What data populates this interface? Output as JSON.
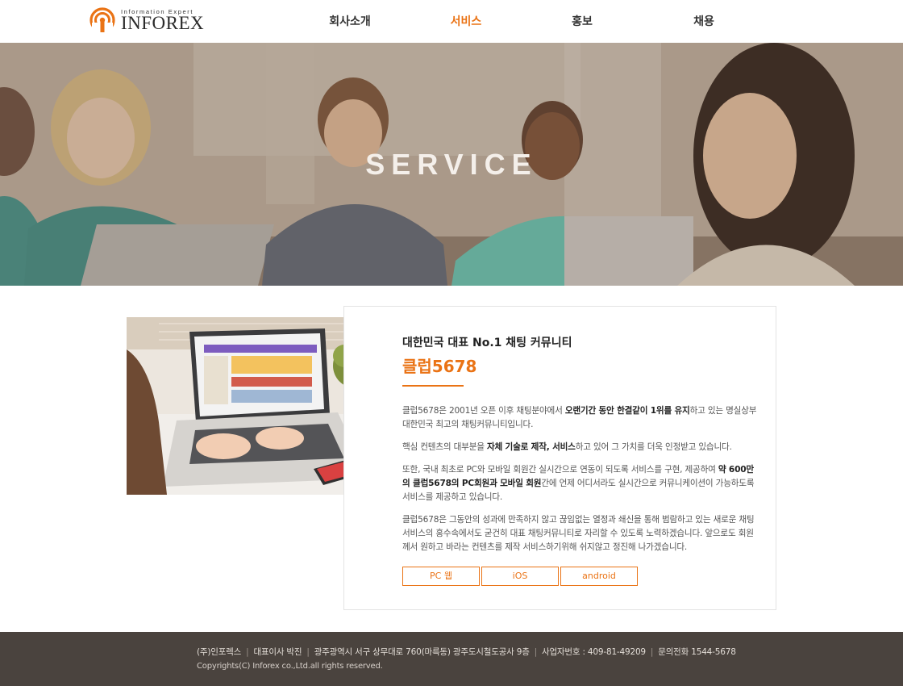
{
  "header": {
    "logo_tagline": "Information Expert",
    "logo_text": "INFOREX",
    "nav": [
      "회사소개",
      "서비스",
      "홍보",
      "채용"
    ],
    "active_nav": "서비스"
  },
  "hero": {
    "title": "SERVICE"
  },
  "content": {
    "subtitle": "대한민국 대표 No.1 채팅 커뮤니티",
    "title": "클럽5678",
    "paragraphs": [
      [
        {
          "t": "클럽5678은 2001년 오픈 이후 채팅분야에서 "
        },
        {
          "t": "오랜기간 동안 한결같이 1위를 유지",
          "b": true
        },
        {
          "t": "하고 있는 명실상부 대한민국 최고의 채팅커뮤니티입니다."
        }
      ],
      [
        {
          "t": "핵심 컨텐츠의 대부분을 "
        },
        {
          "t": "자체 기술로 제작, 서비스",
          "b": true
        },
        {
          "t": "하고 있어 그 가치를 더욱 인정받고 있습니다."
        }
      ],
      [
        {
          "t": "또한, 국내 최초로 PC와 모바일 회원간 실시간으로 연동이 되도록 서비스를 구현, 제공하여 "
        },
        {
          "t": "약 600만의 클럽5678의 PC회원과 모바일 회원",
          "b": true
        },
        {
          "t": "간에 언제 어디서라도 실시간으로 커뮤니케이션이 가능하도록 서비스를 제공하고 있습니다."
        }
      ],
      [
        {
          "t": "클럽5678은 그동안의 성과에 만족하지 않고 끊임없는 열정과 쇄신을 통해 범람하고 있는 새로운 채팅서비스의 홍수속에서도 굳건히 대표 채팅커뮤니티로 자리할 수 있도록 노력하겠습니다. 앞으로도 회원께서 원하고 바라는 컨텐츠를 제작 서비스하기위해 쉬지않고 정진해 나가겠습니다."
        }
      ]
    ],
    "buttons": [
      "PC 웹",
      "iOS",
      "android"
    ]
  },
  "footer": {
    "info": [
      "(주)인포렉스",
      "대표이사 박진",
      "광주광역시 서구 상무대로 760(마륵동) 광주도시철도공사 9층",
      "사업자번호 : 409-81-49209",
      "문의전화 1544-5678"
    ],
    "copyright": "Copyrights(C) Inforex co.,Ltd.all rights reserved."
  },
  "colors": {
    "accent": "#ea7315",
    "footer_bg": "#4a433e",
    "text": "#333333"
  },
  "icons": [
    "inforex-logo-icon"
  ]
}
